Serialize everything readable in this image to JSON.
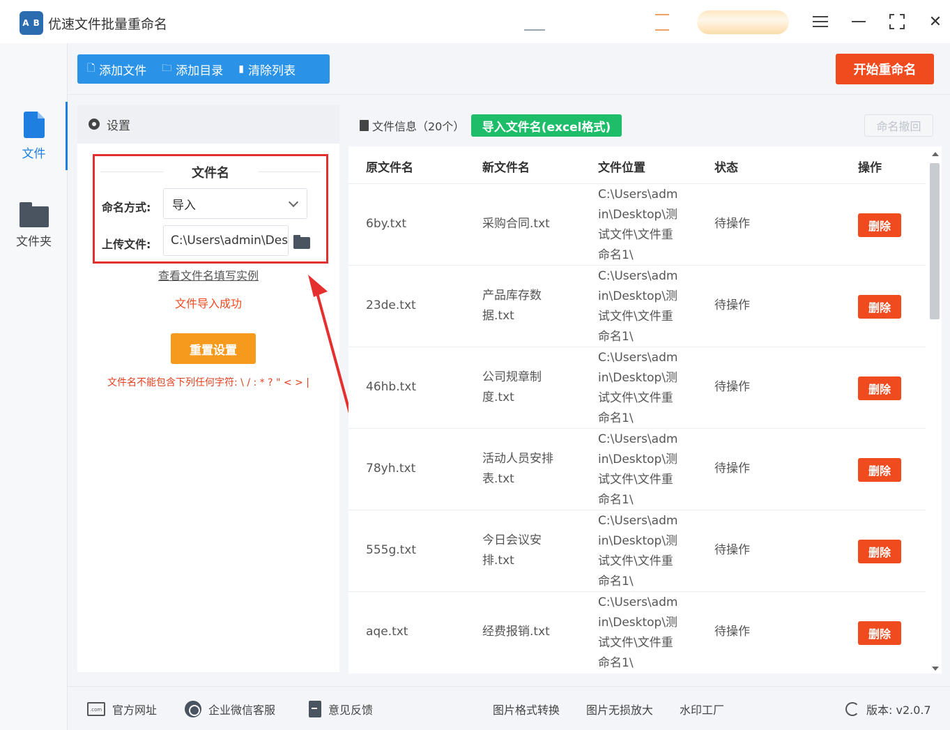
{
  "app": {
    "logo_text": "A B",
    "title": "优速文件批量重命名"
  },
  "nav": {
    "items": [
      {
        "label": "文件",
        "icon": "file-icon",
        "active": true,
        "color": "#1e7fe0"
      },
      {
        "label": "文件夹",
        "icon": "folder-icon",
        "active": false
      }
    ]
  },
  "toolbar": {
    "add_file": "添加文件",
    "add_dir": "添加目录",
    "clear_list": "清除列表",
    "start_rename": "开始重命名"
  },
  "settings": {
    "header": "设置",
    "section_title": "文件名",
    "mode_label": "命名方式:",
    "mode_value": "导入",
    "upload_label": "上传文件:",
    "upload_value": "C:\\Users\\admin\\Desktop",
    "example_link": "查看文件名填写实例",
    "success_text": "文件导入成功",
    "reset_button": "重置设置",
    "warning": "文件名不能包含下列任何字符: \\ / : * ? \" < > |"
  },
  "filelist": {
    "info": "文件信息（20个）",
    "import_button": "导入文件名(excel格式)",
    "undo_button": "命名撤回",
    "columns": {
      "original": "原文件名",
      "new": "新文件名",
      "location": "文件位置",
      "status": "状态",
      "action": "操作"
    },
    "rows": [
      {
        "original": "6by.txt",
        "new": "采购合同.txt",
        "location": "C:\\Users\\admin\\Desktop\\测试文件\\文件重命名1\\",
        "status": "待操作",
        "action": "删除"
      },
      {
        "original": "23de.txt",
        "new": "产品库存数据.txt",
        "location": "C:\\Users\\admin\\Desktop\\测试文件\\文件重命名1\\",
        "status": "待操作",
        "action": "删除"
      },
      {
        "original": "46hb.txt",
        "new": "公司规章制度.txt",
        "location": "C:\\Users\\admin\\Desktop\\测试文件\\文件重命名1\\",
        "status": "待操作",
        "action": "删除"
      },
      {
        "original": "78yh.txt",
        "new": "活动人员安排表.txt",
        "location": "C:\\Users\\admin\\Desktop\\测试文件\\文件重命名1\\",
        "status": "待操作",
        "action": "删除"
      },
      {
        "original": "555g.txt",
        "new": "今日会议安排.txt",
        "location": "C:\\Users\\admin\\Desktop\\测试文件\\文件重命名1\\",
        "status": "待操作",
        "action": "删除"
      },
      {
        "original": "aqe.txt",
        "new": "经费报销.txt",
        "location": "C:\\Users\\admin\\Desktop\\测试文件\\文件重命名1\\",
        "status": "待操作",
        "action": "删除"
      }
    ]
  },
  "footer": {
    "website": "官方网址",
    "wechat": "企业微信客服",
    "feedback": "意见反馈",
    "img_convert": "图片格式转换",
    "img_enlarge": "图片无损放大",
    "watermark": "水印工厂",
    "version": "版本: v2.0.7"
  },
  "colors": {
    "primary_blue": "#2a93e8",
    "start_red": "#f04a1f",
    "import_green": "#1ebd6a",
    "reset_orange": "#f59a1c",
    "highlight_red": "#e03030"
  }
}
